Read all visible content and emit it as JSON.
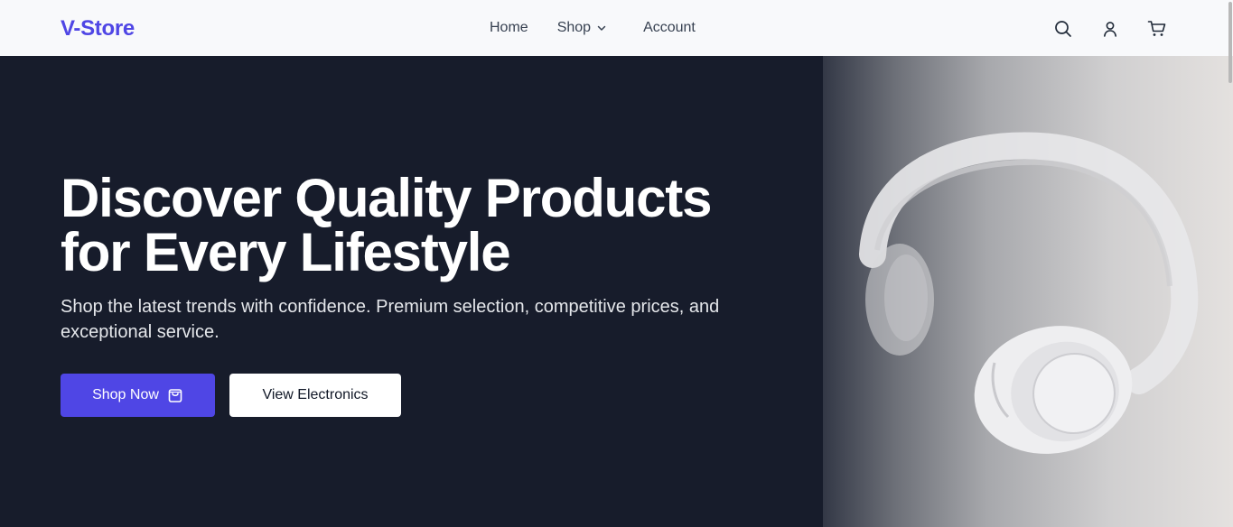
{
  "header": {
    "logo": "V-Store",
    "nav": {
      "home": "Home",
      "shop": "Shop",
      "account": "Account"
    },
    "icons": [
      "search-icon",
      "user-icon",
      "cart-icon"
    ]
  },
  "hero": {
    "title_line1": "Discover Quality Products",
    "title_line2": "for Every Lifestyle",
    "subtitle": "Shop the latest trends with confidence. Premium selection, competitive prices, and exceptional service.",
    "primary_button": "Shop Now",
    "secondary_button": "View Electronics",
    "image_subject": "white headphones"
  },
  "colors": {
    "brand": "#4f46e5",
    "hero_bg": "#171c2b",
    "header_bg": "#f8f9fb"
  }
}
